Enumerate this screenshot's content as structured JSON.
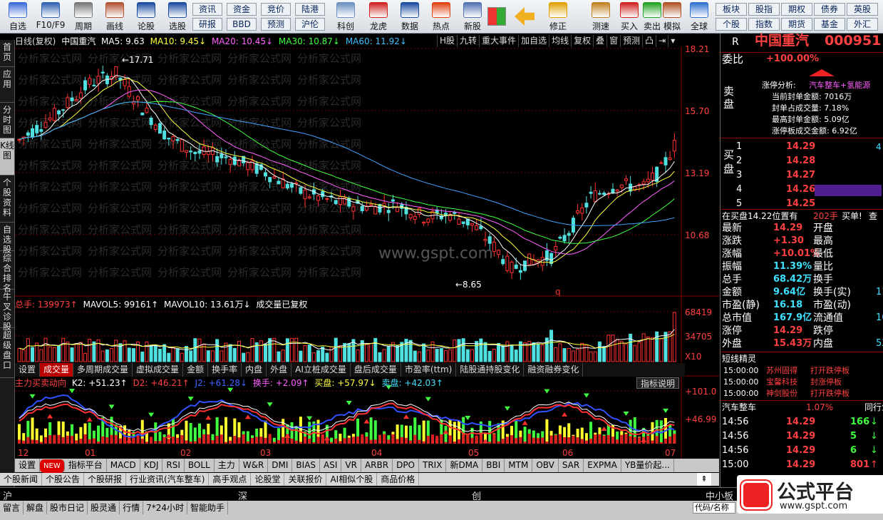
{
  "toolbar": {
    "left": [
      {
        "label": "自选",
        "icon": "star-icon",
        "color": "#3b6bd9"
      },
      {
        "label": "F10/F9",
        "icon": "f10-icon",
        "color": "#2e5fb0"
      },
      {
        "label": "周期",
        "icon": "clock-icon",
        "color": "#777"
      },
      {
        "label": "画线",
        "icon": "pencil-icon",
        "color": "#b05030"
      },
      {
        "label": "论股",
        "icon": "talk-icon",
        "color": "#1a4aa0"
      },
      {
        "label": "选股",
        "icon": "select-icon",
        "color": "#1a4aa0"
      }
    ],
    "grid1": [
      [
        "资讯",
        "研报"
      ],
      [
        "资金",
        "BBD"
      ],
      [
        "竞价",
        "预测"
      ],
      [
        "陆港",
        "沪伦"
      ]
    ],
    "mid": [
      {
        "label": "科创",
        "icon": "chart-icon",
        "color": "#6a8fc0"
      },
      {
        "label": "龙虎",
        "icon": "dragon-icon",
        "color": "#d02020"
      },
      {
        "label": "数据",
        "icon": "pe-icon",
        "color": "#1a4aa0"
      },
      {
        "label": "热点",
        "icon": "fire-icon",
        "color": "#e04010"
      },
      {
        "label": "新股",
        "icon": "ipo-icon",
        "color": "#5070b0"
      }
    ],
    "right": [
      {
        "label": "修正",
        "icon": "up-icon",
        "color": "#e0a000"
      },
      {
        "label": "测速",
        "icon": "timer-icon",
        "color": "#c08020"
      },
      {
        "label": "买入",
        "icon": "buy-icon",
        "color": "#d02020"
      },
      {
        "label": "卖出",
        "icon": "sell-icon",
        "color": "#20a020"
      },
      {
        "label": "模拟",
        "icon": "hammer-icon",
        "color": "#b05020"
      },
      {
        "label": "全球",
        "icon": "globe-icon",
        "color": "#3070d0"
      }
    ],
    "grid2": [
      [
        "板块",
        "个股"
      ],
      [
        "股指",
        "指数"
      ],
      [
        "期权",
        "期货"
      ],
      [
        "债券",
        "基金"
      ],
      [
        "英股",
        "外汇"
      ]
    ]
  },
  "left_tabs": [
    "首页",
    "应用",
    "分时图",
    "K线图",
    "个股资料",
    "自选股",
    "综合排名",
    "牛叉诊股",
    "超级盘口"
  ],
  "header": {
    "period": "日线(复权)",
    "name": "中国重汽",
    "ma5": "MA5: 9.63",
    "ma10": "MA10: 9.45↓",
    "ma20": "MA20: 10.45↓",
    "ma30": "MA30: 10.87↓",
    "ma60": "MA60: 11.92↓",
    "buttons": [
      "H股",
      "九转",
      "重大事件",
      "加自选",
      "均线",
      "复权",
      "叠",
      "窗",
      "预测",
      "凸",
      "⇥",
      "▾"
    ]
  },
  "price_axis": [
    "18.21",
    "15.70",
    "13.19",
    "10.68"
  ],
  "price_annot": {
    "high": "17.71",
    "low": "8.65",
    "site": "www.gspt.com"
  },
  "volume_header": {
    "total": "总手: 139973↑",
    "mavol5": "MAVOL5: 99161↑",
    "mavol10": "MAVOL10: 13.61万↓",
    "note": "成交量已复权"
  },
  "volume_axis": [
    "68419",
    "34705",
    "X10"
  ],
  "volume_tabs": [
    "设置",
    "成交量",
    "多周期成交量",
    "虚拟成交量",
    "金额",
    "换手率",
    "内盘",
    "外盘",
    "AI立桩成交量",
    "盘后成交量",
    "市盈率(ttm)",
    "陆股通持股变化",
    "融资融券变化"
  ],
  "indicator_header": {
    "name": "主力买卖动向",
    "k2": "K2: +51.23↑",
    "d2": "D2: +46.21↑",
    "j2": "J2: +61.28↓",
    "hs": "换手: +2.09↑",
    "mp": "买盘: +57.97↓",
    "sp": "卖盘: +42.03↑",
    "help": "指标说明"
  },
  "indicator_axis": [
    "+101.0",
    "+46.99"
  ],
  "date_axis": [
    "12",
    "01",
    "02",
    "03",
    "04",
    "05",
    "06",
    "07"
  ],
  "indicator_tabs": [
    "设置",
    "NEW",
    "指标平台",
    "MACD",
    "KDJ",
    "RSI",
    "BOLL",
    "主力",
    "W&R",
    "DMI",
    "BIAS",
    "ASI",
    "VR",
    "ARBR",
    "DPO",
    "TRIX",
    "新DMA",
    "BBI",
    "MTM",
    "OBV",
    "SAR",
    "EXPMA",
    "YB量价起..."
  ],
  "news_tabs": [
    "个股新闻",
    "个股公告",
    "个股研报",
    "行业资讯(汽车整车)",
    "高手观点",
    "论股堂",
    "关联报价",
    "AI相似个股",
    "商品价格"
  ],
  "right": {
    "title_name": "中国重汽",
    "title_code": "000951",
    "weibi_label": "委比",
    "weibi_value": "+100.00%",
    "zt_title": "涨停分析:",
    "zt_tags": "汽车整车+氢能源",
    "zt_lines": [
      "当前封单金额: 7016万",
      "封单占成交量: 7.18%",
      "最高封单金额: 5.09亿",
      "涨停板成交金额: 6.92亿"
    ],
    "sell_label": "卖盘",
    "buy_label": "买盘",
    "buys": [
      [
        "1",
        "14.29"
      ],
      [
        "2",
        "14.28"
      ],
      [
        "3",
        "14.27"
      ],
      [
        "4",
        "14.26"
      ],
      [
        "5",
        "14.25"
      ]
    ],
    "buy_edge": "4",
    "inbuy": "在买盘14.22位置有",
    "inbuy_vol": "202手",
    "inbuy_act": "买单!",
    "inbuy_q": "查",
    "stats": [
      [
        "最新",
        "14.29",
        "开盘",
        ""
      ],
      [
        "涨跌",
        "+1.30",
        "最高",
        ""
      ],
      [
        "涨幅",
        "+10.01%",
        "最低",
        ""
      ],
      [
        "振幅",
        "11.39%",
        "量比",
        ""
      ],
      [
        "总手",
        "68.42万",
        "换手",
        ""
      ],
      [
        "金额",
        "9.64亿",
        "换手(实)",
        "11"
      ],
      [
        "市盈(静)",
        "16.18",
        "市盈(动)",
        ""
      ],
      [
        "总市值",
        "167.9亿",
        "流通值",
        "16"
      ],
      [
        "涨停",
        "14.29",
        "跌停",
        ""
      ],
      [
        "外盘",
        "15.43万",
        "内盘",
        "52"
      ]
    ],
    "jl_title": "短线精灵",
    "jl": [
      [
        "15:00:00",
        "苏州固得",
        "打开跌停板"
      ],
      [
        "15:00:00",
        "宝馨科技",
        "封涨停板"
      ],
      [
        "15:00:00",
        "神剑股份",
        "打开跌停板"
      ]
    ],
    "sector": "汽车整车",
    "sector_pct": "1.07%",
    "sector_btn": "同行业",
    "ticks": [
      [
        "14:56",
        "14.29",
        "166",
        "down"
      ],
      [
        "14:56",
        "14.29",
        "5",
        "down"
      ],
      [
        "14:56",
        "14.29",
        "6",
        "down"
      ],
      [
        "15:00",
        "14.29",
        "801",
        "up"
      ]
    ],
    "r_letter": "R"
  },
  "status1": {
    "sh": "沪",
    "sz": "深",
    "cy": "创",
    "zx": "中小板"
  },
  "status2": [
    "留言",
    "解盘",
    "股市日记",
    "股灵通",
    "行情",
    "7*24小时",
    "智能助手"
  ],
  "status2_right": "代码/名称",
  "logo": {
    "name": "公式平台",
    "url": "www.gspt.com"
  },
  "watermark": "分析家公式网"
}
